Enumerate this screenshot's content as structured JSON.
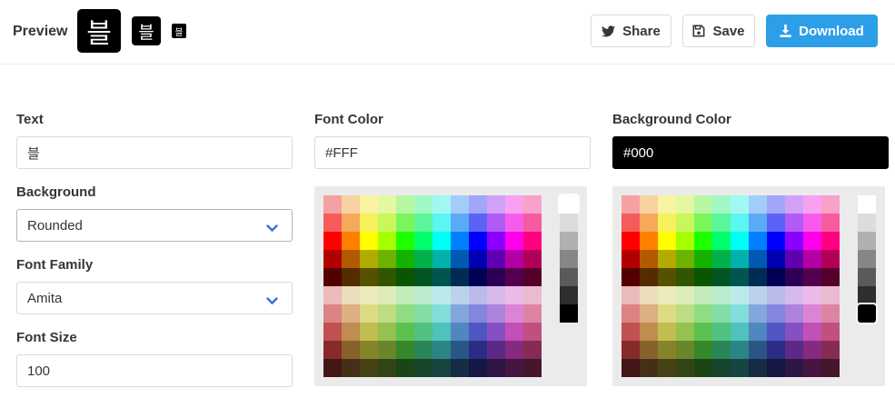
{
  "header": {
    "preview_label": "Preview",
    "preview_glyph": "블",
    "share_label": "Share",
    "save_label": "Save",
    "download_label": "Download"
  },
  "form": {
    "text_label": "Text",
    "text_value": "블",
    "background_label": "Background",
    "background_value": "Rounded",
    "font_family_label": "Font Family",
    "font_family_value": "Amita",
    "font_size_label": "Font Size",
    "font_size_value": "100",
    "font_color_label": "Font Color",
    "font_color_value": "#FFF",
    "background_color_label": "Background Color",
    "background_color_value": "#000"
  },
  "colors": {
    "accent": "#2d9fe8",
    "swatch_rows": [
      [
        "#f6a1a1",
        "#f8d2a1",
        "#f8f4a1",
        "#e3f8a1",
        "#b6f8a1",
        "#a1f8c5",
        "#a1f8f3",
        "#a1cdf8",
        "#a1a6f8",
        "#d1a1f8",
        "#f8a1f3",
        "#f8a1c9"
      ],
      [
        "#f55b5b",
        "#f6a95b",
        "#f6f15b",
        "#c9f65b",
        "#79f65b",
        "#5bf69c",
        "#5bf6f1",
        "#5baaf6",
        "#5b62f6",
        "#b05bf6",
        "#f65bee",
        "#f65b9f"
      ],
      [
        "#ff0000",
        "#ff8000",
        "#ffff00",
        "#a6ff00",
        "#1eff00",
        "#00ff6e",
        "#00fff5",
        "#0080ff",
        "#0000ff",
        "#8b00ff",
        "#ff00ec",
        "#ff0080"
      ],
      [
        "#b20000",
        "#b25a00",
        "#b2ab00",
        "#6eb200",
        "#16b200",
        "#00b24c",
        "#00b2ab",
        "#005ab2",
        "#0000b2",
        "#6100b2",
        "#b200a5",
        "#b20059"
      ],
      [
        "#550000",
        "#552b00",
        "#555100",
        "#325500",
        "#0a5500",
        "#005524",
        "#005551",
        "#002b55",
        "#000055",
        "#2e0055",
        "#55004f",
        "#55002a"
      ],
      [
        "#ebbaba",
        "#ebdcba",
        "#ebeaba",
        "#deebba",
        "#c3ebba",
        "#baebcf",
        "#baebea",
        "#bad3eb",
        "#babbeb",
        "#d5baeb",
        "#ebbae9",
        "#ebbad1"
      ],
      [
        "#dd8383",
        "#ddaf83",
        "#dddb83",
        "#bedd83",
        "#8fdd83",
        "#83dda7",
        "#83dddb",
        "#83a6dd",
        "#8386dd",
        "#ad83dd",
        "#dd83d6",
        "#dd83a4"
      ],
      [
        "#c15050",
        "#c18c50",
        "#c1bd50",
        "#94c150",
        "#5ac150",
        "#50c17f",
        "#50c1bd",
        "#5087c1",
        "#5056c1",
        "#8750c1",
        "#c150b8",
        "#c15080"
      ],
      [
        "#862a2a",
        "#86622a",
        "#86842a",
        "#6a862a",
        "#36862a",
        "#2a8658",
        "#2a8684",
        "#2a5686",
        "#2a2c86",
        "#5c2a86",
        "#862a80",
        "#862a56"
      ],
      [
        "#451616",
        "#452f16",
        "#454216",
        "#334516",
        "#1c4516",
        "#16452c",
        "#164542",
        "#162c45",
        "#161745",
        "#2e1645",
        "#451641",
        "#45162c"
      ]
    ],
    "grays": [
      "#ffffff",
      "#dcdcdc",
      "#b0b0b0",
      "#868686",
      "#5a5a5a",
      "#2e2e2e",
      "#000000"
    ],
    "font_color_selected_gray": 0,
    "background_color_selected_gray": 6
  }
}
